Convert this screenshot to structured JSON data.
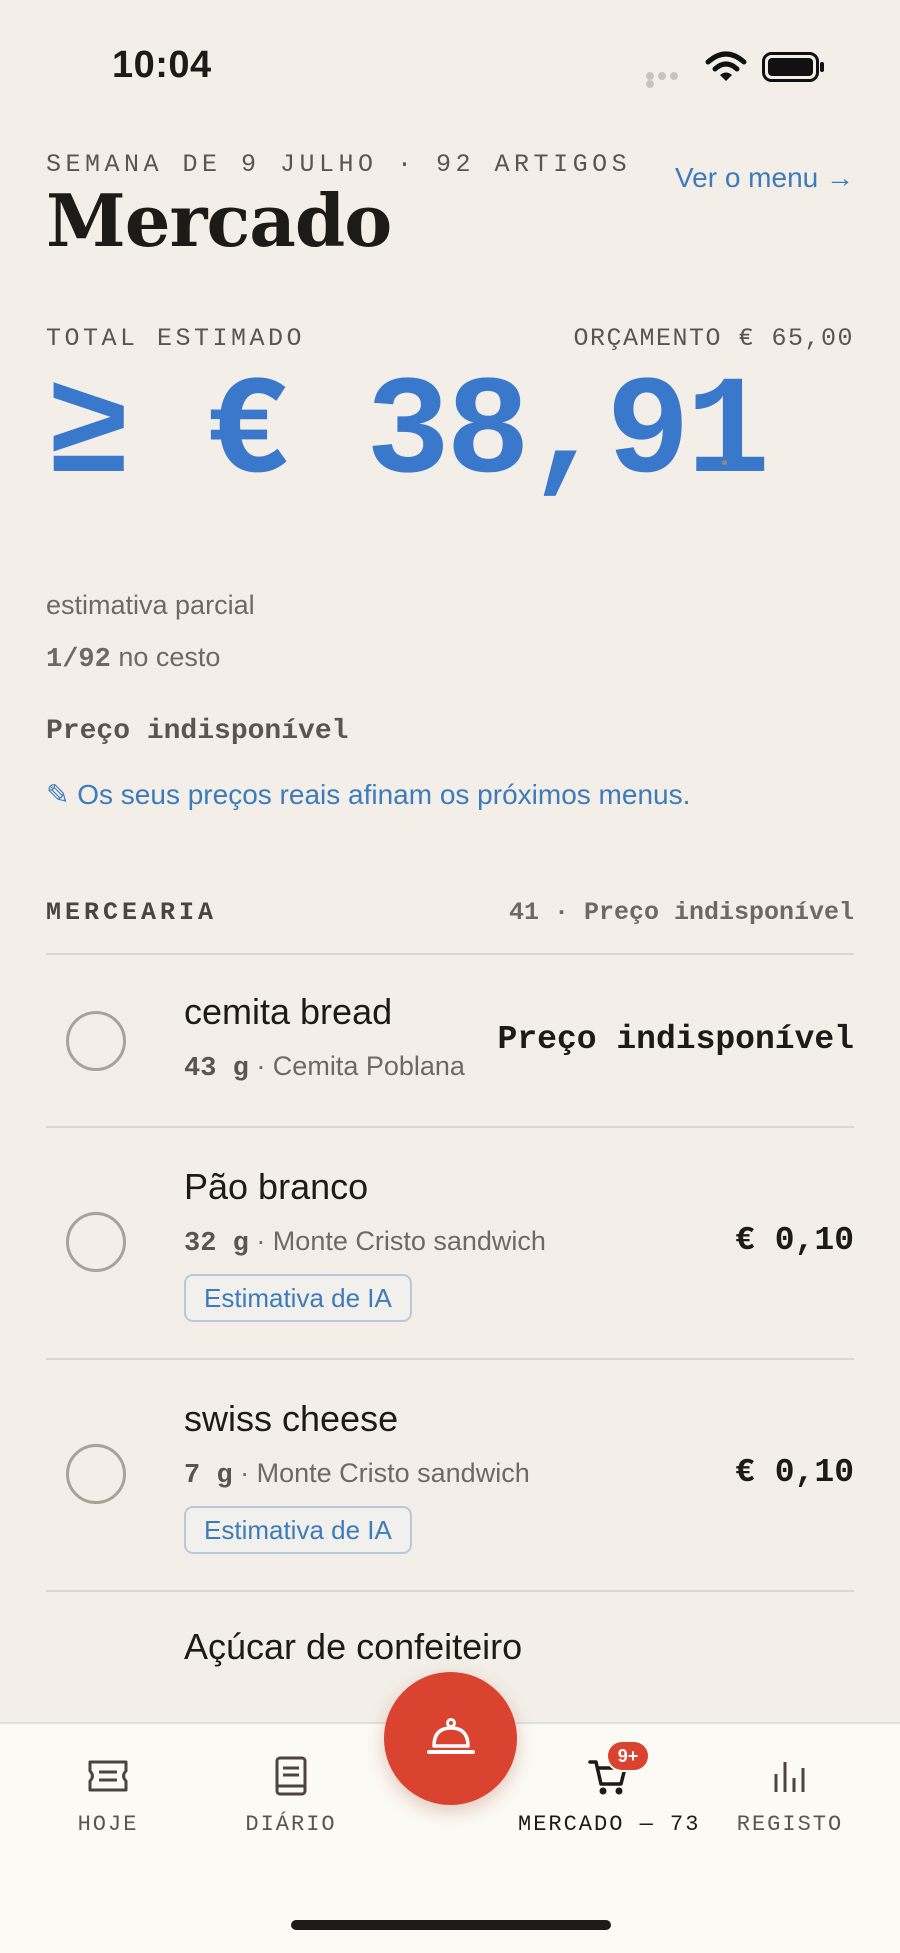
{
  "status_bar": {
    "time": "10:04"
  },
  "header": {
    "week_line": "SEMANA DE 9 JULHO · 92 ARTIGOS",
    "title": "Mercado",
    "menu_link": "Ver o menu →"
  },
  "totals": {
    "label": "TOTAL ESTIMADO",
    "budget": "ORÇAMENTO € 65,00",
    "amount": "≥ € 38,91",
    "partial_label": "estimativa parcial",
    "basket_count": "1/92",
    "basket_suffix": " no cesto",
    "unavailable": "Preço indisponível",
    "info_link": "✎ Os seus preços reais afinam os próximos menus."
  },
  "section": {
    "name": "MERCEARIA",
    "meta": "41 · Preço indisponível"
  },
  "items": [
    {
      "name": "cemita bread",
      "qty": "43  g",
      "recipe": " · Cemita Poblana",
      "price": "Preço indisponível",
      "badge": ""
    },
    {
      "name": "Pão branco",
      "qty": "32  g",
      "recipe": " · Monte Cristo sandwich",
      "price": "€ 0,10",
      "badge": "Estimativa de IA"
    },
    {
      "name": "swiss cheese",
      "qty": "7  g",
      "recipe": " · Monte Cristo sandwich",
      "price": "€ 0,10",
      "badge": "Estimativa de IA"
    },
    {
      "name": "Açúcar de confeiteiro",
      "qty": "",
      "recipe": "",
      "price": "",
      "badge": ""
    }
  ],
  "tabbar": {
    "tabs": [
      {
        "label": "HOJE",
        "icon": "ticket-icon"
      },
      {
        "label": "DIÁRIO",
        "icon": "book-icon"
      },
      {
        "label": "MERCADO — 73",
        "icon": "cart-icon"
      },
      {
        "label": "REGISTO",
        "icon": "chart-icon"
      }
    ],
    "cart_badge": "9+",
    "fab_icon": "cloche-icon"
  },
  "colors": {
    "accent_blue": "#3a78cc",
    "fab_red": "#d9432f",
    "background": "#f3efe8"
  }
}
